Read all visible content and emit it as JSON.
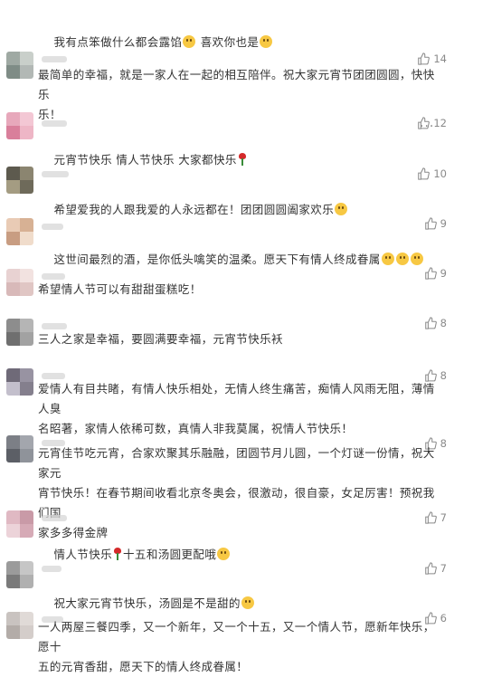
{
  "comments": [
    {
      "text": "我有点笨做什么都会露馅",
      "text2": " 喜欢你也是",
      "likes": ""
    },
    {
      "text": "最简单的幸福，就是一家人在一起的相互陪伴。祝大家元宵节团团圆圆，快快乐\n乐！",
      "likes": "14"
    },
    {
      "text": "元宵节快乐 情人节快乐 大家都快乐",
      "likes": "12"
    },
    {
      "text": "希望爱我的人跟我爱的人永远都在！团团圆圆阖家欢乐",
      "likes": "10"
    },
    {
      "text": "这世间最烈的酒，是你低头噙笑的温柔。愿天下有情人终成眷属",
      "likes": "9"
    },
    {
      "text": "希望情人节可以有甜甜蛋糕吃！",
      "likes": "9"
    },
    {
      "text": "三人之家是幸福，要圆满要幸福，元宵节快乐袄",
      "likes": "8"
    },
    {
      "text": "爱情人有目共睹，有情人快乐相处，无情人终生痛苦，痴情人风雨无阻，薄情人臭\n名昭著，家情人依稀可数，真情人非我莫属，祝情人节快乐！",
      "likes": "8"
    },
    {
      "text": "元宵佳节吃元宵，合家欢聚其乐融融，团圆节月儿圆，一个灯谜一份情，祝大家元\n宵节快乐！在春节期间收看北京冬奥会，很激动，很自豪，女足厉害！预祝我们国\n家多多得金牌",
      "likes": "8"
    },
    {
      "text": "情人节快乐",
      "text2": "十五和汤圆更配哦",
      "likes": "7"
    },
    {
      "text": "祝大家元宵节快乐，汤圆是不是甜的",
      "likes": "7"
    },
    {
      "text": "一人两屋三餐四季，又一个新年，又一个十五，又一个情人节，愿新年快乐，愿十\n五的元宵香甜，愿天下的情人终成眷属！",
      "likes": "6"
    }
  ],
  "more_icon": "···",
  "icons": {
    "like": "thumbs-up-icon",
    "emoji": "smile-emoji-icon",
    "rose": "rose-icon"
  }
}
